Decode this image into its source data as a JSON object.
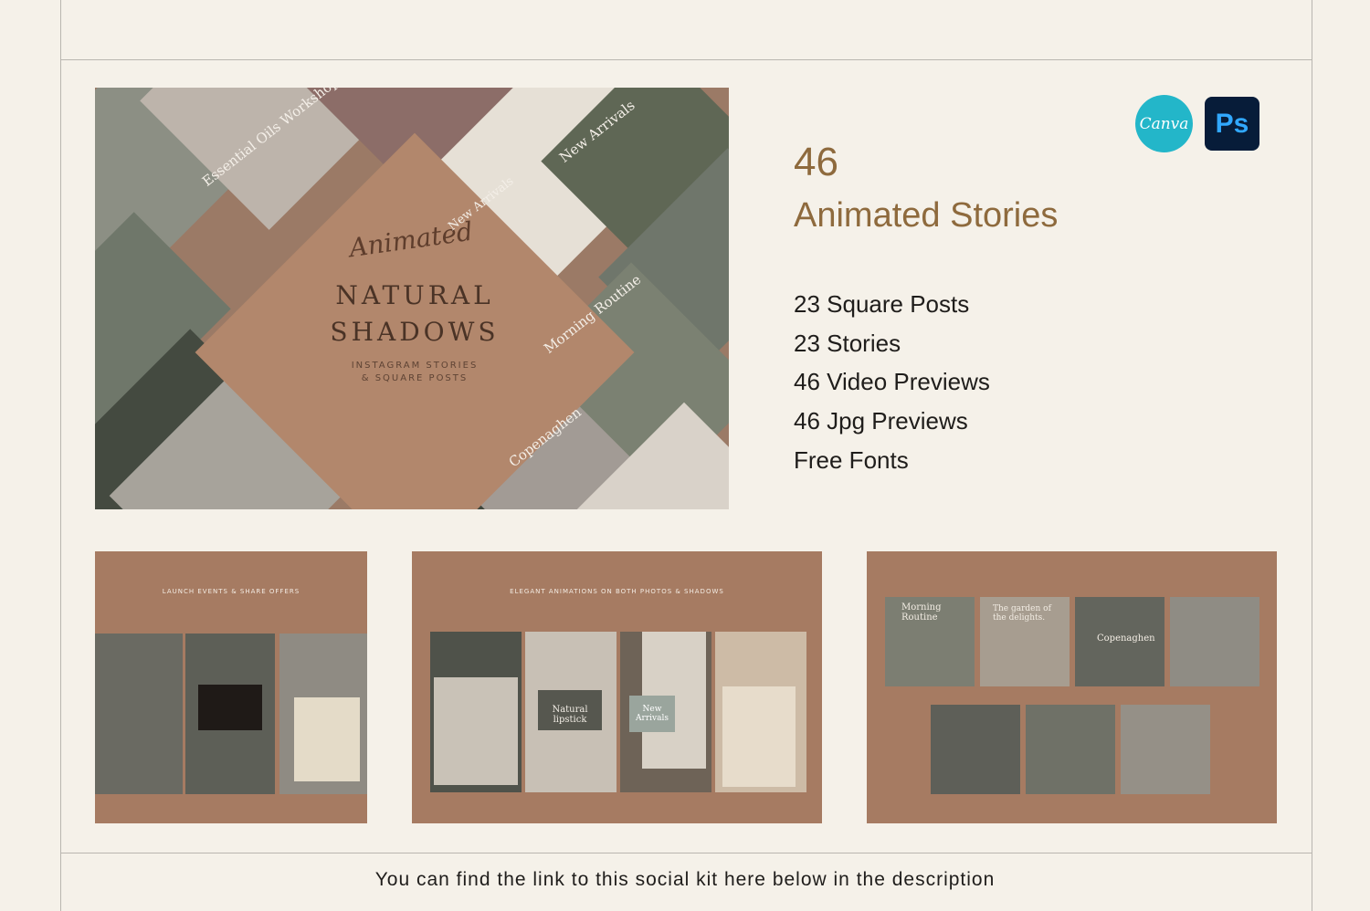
{
  "hero": {
    "script_title": "Animated",
    "title_line1": "NATURAL",
    "title_line2": "SHADOWS",
    "subtitle_line1": "INSTAGRAM STORIES",
    "subtitle_line2": "& SQUARE POSTS",
    "tile_labels": [
      "Essential Oils Workshop",
      "New Arrivals",
      "New Arrivals",
      "Morning Routine",
      "Copenaghen"
    ]
  },
  "logos": {
    "canva": "Canva",
    "photoshop": "Ps"
  },
  "headline": {
    "count": "46",
    "title": "Animated Stories"
  },
  "features": [
    "23 Square Posts",
    "23 Stories",
    "46 Video Previews",
    "46 Jpg Previews",
    "Free Fonts"
  ],
  "panels": [
    {
      "caption": "LAUNCH EVENTS & SHARE OFFERS"
    },
    {
      "caption": "ELEGANT ANIMATIONS ON BOTH PHOTOS & SHADOWS"
    },
    {
      "caption": ""
    }
  ],
  "panel_labels": {
    "natural_lipstick": "Natural lipstick",
    "new_arrivals": "New Arrivals",
    "morning_routine": "Morning Routine",
    "garden": "The garden of the delights.",
    "copenaghen": "Copenaghen"
  },
  "footer": {
    "text": "You can find the link to this social kit here below in the description"
  },
  "colors": {
    "accent": "#8e6a3d",
    "background": "#f5f1e9",
    "panel": "#a67b62"
  }
}
